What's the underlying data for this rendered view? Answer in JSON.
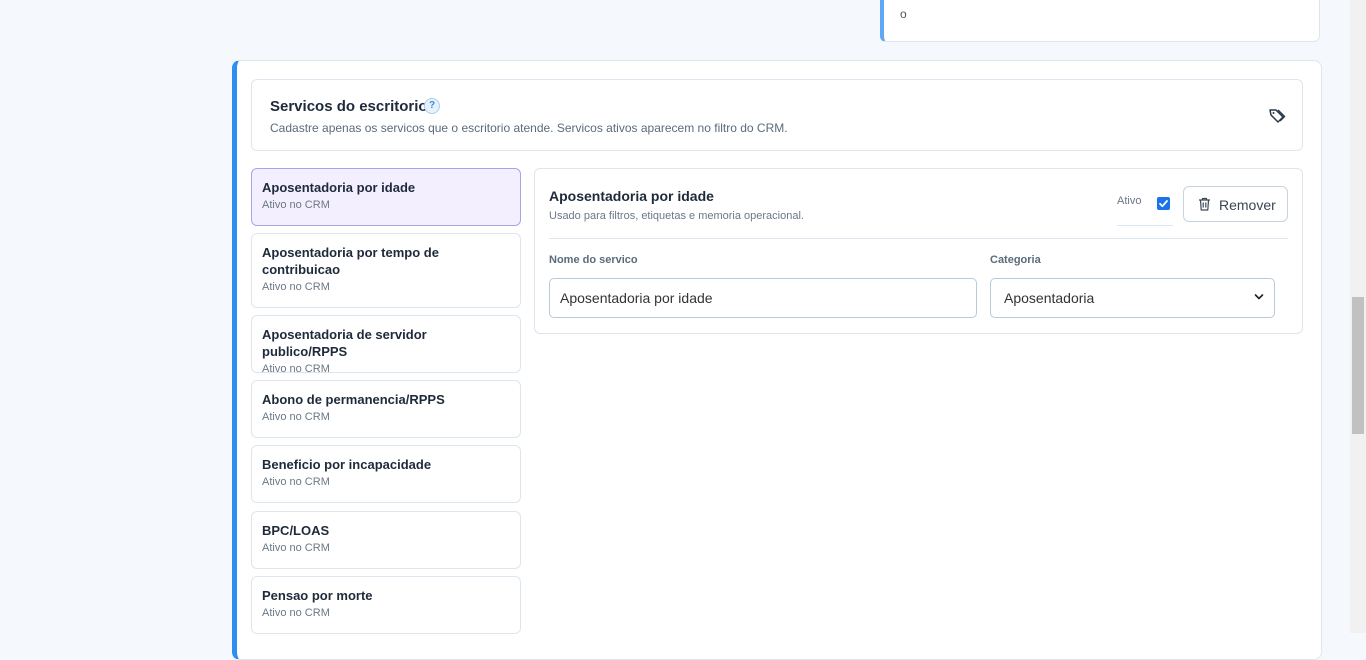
{
  "top_card": {
    "text": "o"
  },
  "section": {
    "title": "Servicos do escritorio",
    "subtitle": "Cadastre apenas os servicos que o escritorio atende. Servicos ativos aparecem no filtro do CRM.",
    "help_icon": "question-circle-icon",
    "tag_icon": "tags-icon"
  },
  "services": [
    {
      "name": "Aposentadoria por idade",
      "status": "Ativo no CRM",
      "selected": true
    },
    {
      "name": "Aposentadoria por tempo de contribuicao",
      "status": "Ativo no CRM"
    },
    {
      "name": "Aposentadoria de servidor publico/RPPS",
      "status": "Ativo no CRM"
    },
    {
      "name": "Abono de permanencia/RPPS",
      "status": "Ativo no CRM"
    },
    {
      "name": "Beneficio por incapacidade",
      "status": "Ativo no CRM"
    },
    {
      "name": "BPC/LOAS",
      "status": "Ativo no CRM"
    },
    {
      "name": "Pensao por morte",
      "status": "Ativo no CRM"
    }
  ],
  "detail": {
    "title": "Aposentadoria por idade",
    "subtitle": "Usado para filtros, etiquetas e memoria operacional.",
    "active_label": "Ativo",
    "active_checked": true,
    "remove_label": "Remover",
    "name_label": "Nome do servico",
    "name_value": "Aposentadoria por idade",
    "category_label": "Categoria",
    "category_value": "Aposentadoria"
  },
  "colors": {
    "accent": "#2f8ef0",
    "selected_bg": "#f4efff",
    "checkbox": "#1a73e8"
  }
}
